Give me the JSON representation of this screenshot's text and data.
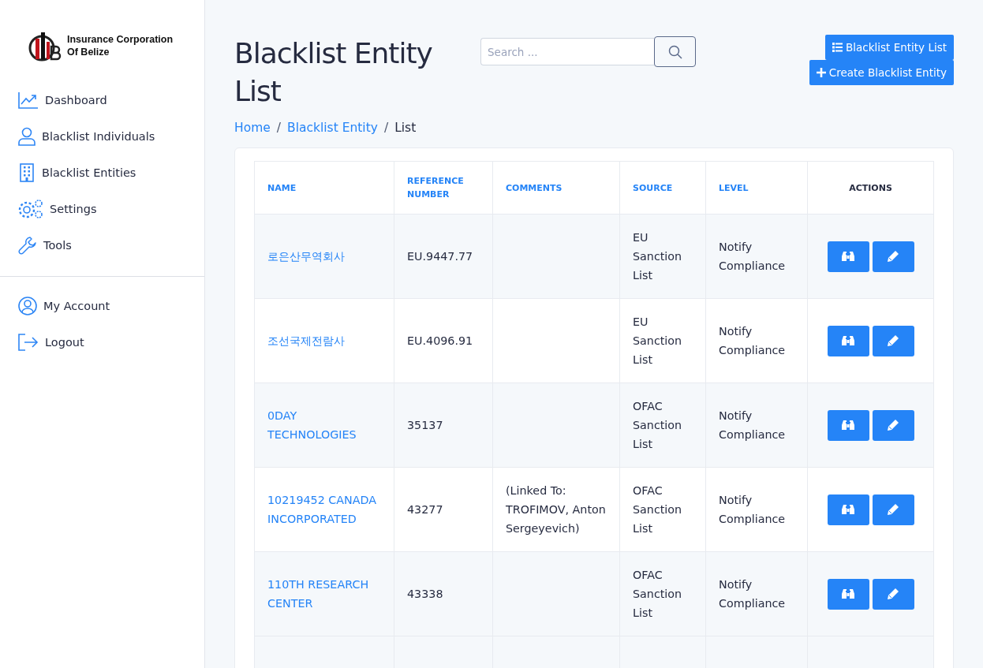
{
  "sidebar": {
    "brand": {
      "line1": "Insurance Corporation",
      "line2": "Of Belize"
    },
    "items": [
      {
        "kind": "chart",
        "label": "Dashboard"
      },
      {
        "kind": "person",
        "label": "Blacklist Individuals"
      },
      {
        "kind": "building",
        "label": "Blacklist Entities"
      },
      {
        "kind": "gears",
        "label": "Settings"
      },
      {
        "kind": "wrench",
        "label": "Tools"
      }
    ],
    "account_items": [
      {
        "kind": "account",
        "label": "My Account"
      },
      {
        "kind": "logout",
        "label": "Logout"
      }
    ]
  },
  "header": {
    "title": "Blacklist Entity List",
    "search": {
      "placeholder": "Search ..."
    },
    "buttons": [
      {
        "kind": "list",
        "label": "Blacklist Entity List"
      },
      {
        "kind": "plus",
        "label": "Create Blacklist Entity"
      }
    ]
  },
  "breadcrumb_separators": [
    "/",
    "/"
  ],
  "breadcrumb": [
    {
      "label": "Home",
      "link": true
    },
    {
      "label": "Blacklist Entity",
      "link": true
    },
    {
      "label": "List",
      "link": false
    }
  ],
  "table": {
    "columns": [
      "NAME",
      "REFERENCE NUMBER",
      "COMMENTS",
      "SOURCE",
      "LEVEL",
      "ACTIONS"
    ],
    "rows": [
      {
        "name": "로은산무역회사",
        "reference": "EU.9447.77",
        "source": "EU Sanction List",
        "level": "Notify Compliance"
      },
      {
        "name": "조선국제전람사",
        "reference": "EU.4096.91",
        "source": "EU Sanction List",
        "level": "Notify Compliance"
      },
      {
        "name": "0DAY TECHNOLOGIES",
        "reference": "35137",
        "source": "OFAC Sanction List",
        "level": "Notify Compliance"
      },
      {
        "name": "10219452 CANADA INCORPORATED",
        "reference": "43277",
        "comments": "(Linked To: TROFIMOV, Anton Sergeyevich)",
        "source": "OFAC Sanction List",
        "level": "Notify Compliance"
      },
      {
        "name": "110TH RESEARCH CENTER",
        "reference": "43338",
        "source": "OFAC Sanction List",
        "level": "Notify Compliance"
      }
    ]
  }
}
